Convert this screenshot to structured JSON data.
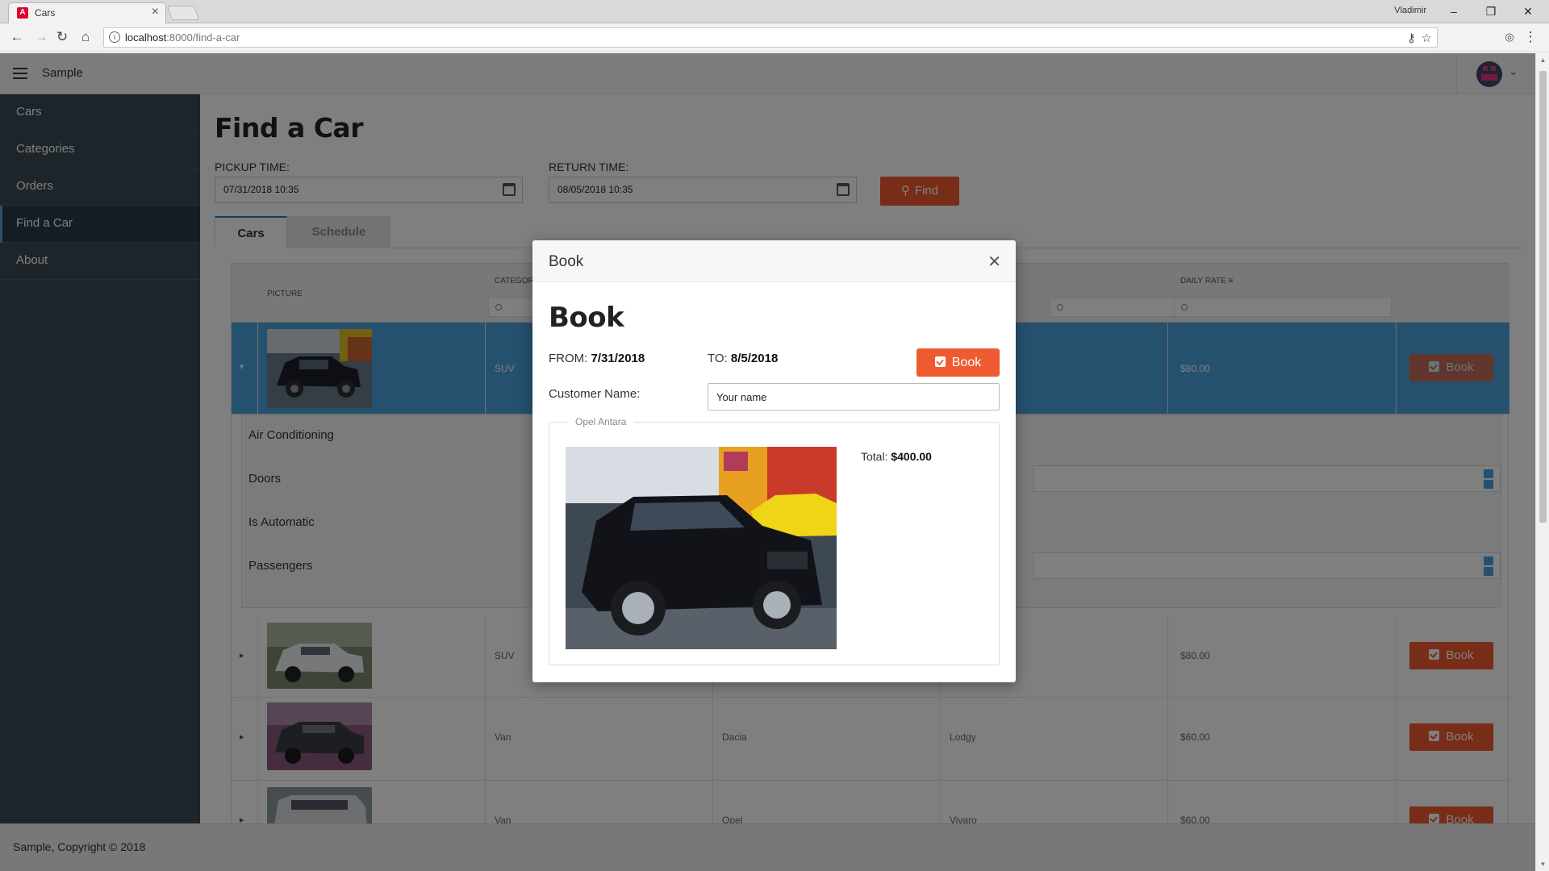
{
  "browser": {
    "tab_title": "Cars",
    "tab_icon": "angular-icon",
    "user_name": "Vladimir",
    "url_host": "localhost",
    "url_rest": ":8000/find-a-car"
  },
  "app": {
    "title": "Sample",
    "menu_icon": "hamburger-menu-icon"
  },
  "sidebar": {
    "items": [
      {
        "label": "Cars"
      },
      {
        "label": "Categories"
      },
      {
        "label": "Orders"
      },
      {
        "label": "Find a Car",
        "active": true
      },
      {
        "label": "About"
      }
    ]
  },
  "page": {
    "title": "Find a Car",
    "pickup_label": "PICKUP TIME:",
    "pickup_value": "07/31/2018 10:35",
    "return_label": "RETURN TIME:",
    "return_value": "08/05/2018 10:35",
    "find_label": "Find",
    "tabs": [
      {
        "label": "Cars"
      },
      {
        "label": "Schedule"
      }
    ]
  },
  "grid": {
    "columns": [
      "PICTURE",
      "CATEGORY",
      "DAILY RATE"
    ],
    "rows": [
      {
        "category": "SUV",
        "make": "",
        "model": "",
        "rate": "$80.00",
        "book": "Book",
        "selected": true
      },
      {
        "category": "SUV",
        "make": "",
        "model": "",
        "rate": "$80.00",
        "book": "Book"
      },
      {
        "category": "Van",
        "make": "Dacia",
        "model": "Lodgy",
        "rate": "$60.00",
        "book": "Book"
      },
      {
        "category": "Van",
        "make": "Opel",
        "model": "Vivaro",
        "rate": "$60.00",
        "book": "Book"
      }
    ],
    "detail_fields": [
      "Air Conditioning",
      "Doors",
      "Is Automatic",
      "Passengers"
    ]
  },
  "footer": {
    "copyright": "Sample, Copyright © 2018"
  },
  "modal": {
    "header": "Book",
    "heading": "Book",
    "from_label": "FROM:",
    "from_value": "7/31/2018",
    "to_label": "TO:",
    "to_value": "8/5/2018",
    "book_label": "Book",
    "customer_label": "Customer Name:",
    "customer_value": "Your name",
    "car_name": "Opel Antara",
    "total_label": "Total:",
    "total_value": "$400.00"
  },
  "colors": {
    "accent": "#ef5b30",
    "selected_row": "#4aa3df",
    "sidebar": "#3a4a55"
  }
}
